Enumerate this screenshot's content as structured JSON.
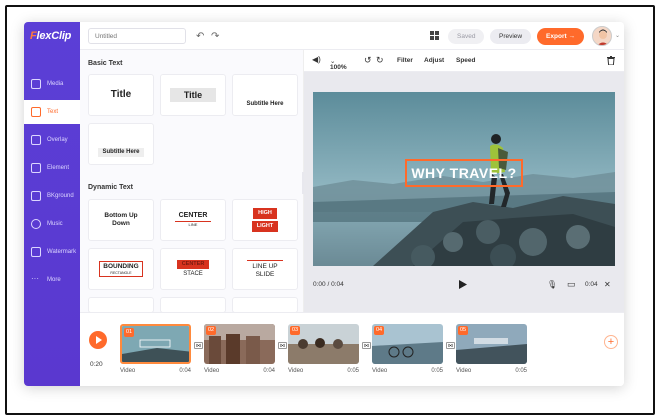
{
  "app": {
    "logo_prefix": "F",
    "logo_text": "lexClip"
  },
  "header": {
    "title_placeholder": "Untitled",
    "saved_label": "Saved",
    "preview_label": "Preview",
    "export_label": "Export →"
  },
  "sidebar": {
    "items": [
      {
        "label": "Media"
      },
      {
        "label": "Text"
      },
      {
        "label": "Overlay"
      },
      {
        "label": "Element"
      },
      {
        "label": "BKground"
      },
      {
        "label": "Music"
      },
      {
        "label": "Watermark"
      },
      {
        "label": "More"
      }
    ]
  },
  "panel": {
    "basic_heading": "Basic Text",
    "dynamic_heading": "Dynamic Text",
    "basic": [
      "Title",
      "Title",
      "Subtitle Here",
      "Subtitle Here"
    ],
    "dynamic": {
      "bottom_up": "Bottom Up Down",
      "center": "CENTER",
      "center_sub": "LINE",
      "high": "HIGH",
      "light": "LIGHT",
      "bounding": "BOUNDING",
      "bounding_sub": "RECTANGLE",
      "center_stage_top": "CENTER",
      "center_stage": "STACE",
      "line_up": "LINE UP SLIDE"
    }
  },
  "toolbar": {
    "zoom": "100%",
    "filter": "Filter",
    "adjust": "Adjust",
    "speed": "Speed"
  },
  "canvas": {
    "overlay_text": "WHY TRAVEL?",
    "current_time": "0:00 / 0:04",
    "duration": "0:04"
  },
  "timeline": {
    "time": "0:20",
    "clips": [
      {
        "num": "01",
        "type": "Video",
        "dur": "0:04"
      },
      {
        "num": "02",
        "type": "Video",
        "dur": "0:04"
      },
      {
        "num": "03",
        "type": "Video",
        "dur": "0:05"
      },
      {
        "num": "04",
        "type": "Video",
        "dur": "0:05"
      },
      {
        "num": "05",
        "type": "Video",
        "dur": "0:05"
      }
    ]
  },
  "colors": {
    "accent": "#ff6a2b",
    "sidebar": "#5b3fd6"
  }
}
